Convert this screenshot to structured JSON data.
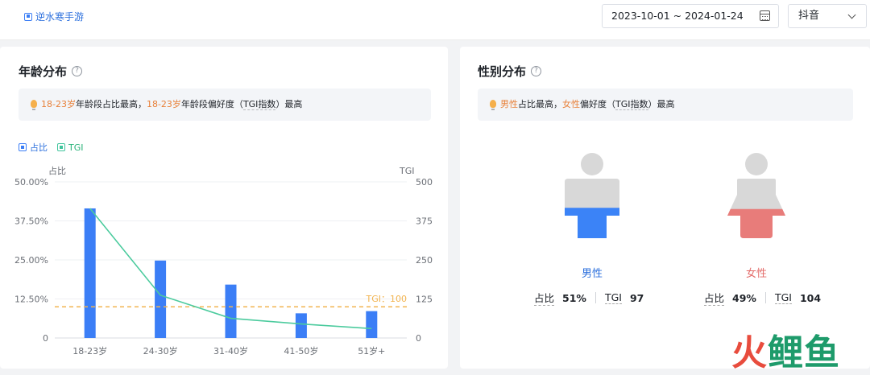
{
  "topbar": {
    "app_name": "逆水寒手游",
    "date_range": "2023-10-01 ~ 2024-01-24",
    "platform": "抖音"
  },
  "age_card": {
    "title": "年龄分布",
    "insight": {
      "seg1": "18-23岁",
      "text1": "年龄段占比最高，",
      "seg2": "18-23岁",
      "text2": "年龄段偏好度（",
      "tgi": "TGI指数",
      "text3": "）最高"
    },
    "legend": {
      "share": "占比",
      "tgi": "TGI"
    }
  },
  "gender_card": {
    "title": "性别分布",
    "insight": {
      "male": "男性",
      "text1": "占比最高，",
      "female": "女性",
      "text2": "偏好度（",
      "tgi": "TGI指数",
      "text3": "）最高"
    },
    "male": {
      "name": "男性",
      "share_label": "占比",
      "share": "51%",
      "tgi_label": "TGI",
      "tgi": "97",
      "color": "#3b83f7",
      "fill": 0.51
    },
    "female": {
      "name": "女性",
      "share_label": "占比",
      "share": "49%",
      "tgi_label": "TGI",
      "tgi": "104",
      "color": "#e87c7a",
      "fill": 0.49
    }
  },
  "chart_data": {
    "type": "bar",
    "categories": [
      "18-23岁",
      "24-30岁",
      "31-40岁",
      "41-50岁",
      "51岁+"
    ],
    "series": [
      {
        "name": "占比",
        "type": "bar",
        "values": [
          41.5,
          24.8,
          17.1,
          7.9,
          8.6
        ],
        "axis": "left",
        "color": "#3b7ef6"
      },
      {
        "name": "TGI",
        "type": "line",
        "values": [
          415,
          137,
          63,
          45,
          30
        ],
        "axis": "right",
        "color": "#4ccb9e"
      }
    ],
    "ylabel_left": "占比",
    "ylabel_right": "TGI",
    "ylim_left": [
      0,
      50
    ],
    "ylim_right": [
      0,
      500
    ],
    "yticks_left": [
      "0",
      "12.50%",
      "25.00%",
      "37.50%",
      "50.00%"
    ],
    "yticks_right": [
      "0",
      "125",
      "250",
      "375",
      "500"
    ],
    "reference_line": {
      "label": "TGI：100",
      "value": 100,
      "axis": "right",
      "color": "#f2b450"
    },
    "grid": true,
    "legend": "top-left"
  },
  "watermark": {
    "fire": "火",
    "rest": "鲤鱼"
  }
}
